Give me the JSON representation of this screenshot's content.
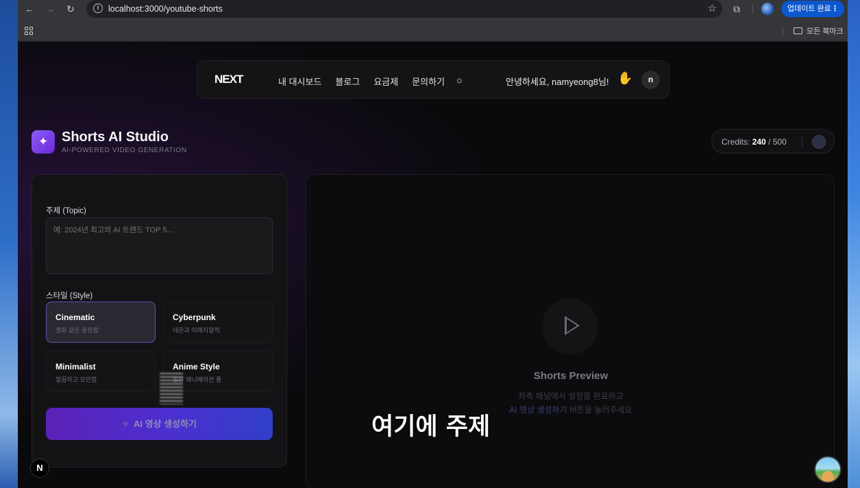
{
  "browser": {
    "url": "localhost:3000/youtube-shorts",
    "update_label": "업데이트 완료",
    "bookmarks_folder": "모든 북마크"
  },
  "nav": {
    "logo": "NEXT",
    "links": [
      "내 대시보드",
      "블로그",
      "요금제",
      "문의하기"
    ],
    "greeting": "안녕하세요, namyeong8님!",
    "avatar_letter": "n"
  },
  "studio": {
    "title": "Shorts AI Studio",
    "subtitle": "AI-POWERED VIDEO GENERATION"
  },
  "credits": {
    "label": "Credits:",
    "used": "240",
    "sep": "/",
    "total": "500"
  },
  "form": {
    "topic_label": "주제 (Topic)",
    "topic_placeholder": "예: 2024년 최고의 AI 트렌드 TOP 5...",
    "style_label": "스타일 (Style)",
    "styles": [
      {
        "name": "Cinematic",
        "desc": "영화 같은 웅장함",
        "active": true
      },
      {
        "name": "Cyberpunk",
        "desc": "네온과 미래지향적",
        "active": false
      },
      {
        "name": "Minimalist",
        "desc": "깔끔하고 모던함",
        "active": false
      },
      {
        "name": "Anime Style",
        "desc": "일본 애니메이션 풍",
        "active": false
      }
    ],
    "generate_label": "AI 영상 생성하기"
  },
  "preview": {
    "title": "Shorts Preview",
    "line1": "좌측 패널에서 설정을 완료하고",
    "line2_highlight": "AI 영상 생성하기",
    "line2_rest": " 버튼을 눌러주세요"
  },
  "overlay_subtitle": "여기에 주제",
  "badge_letter": "N",
  "colors": {
    "accent_purple": "#6d28d9",
    "button_gradient_start": "#5b21b6",
    "button_gradient_end": "#2f3fc8",
    "page_bg": "#0a0a0c"
  }
}
